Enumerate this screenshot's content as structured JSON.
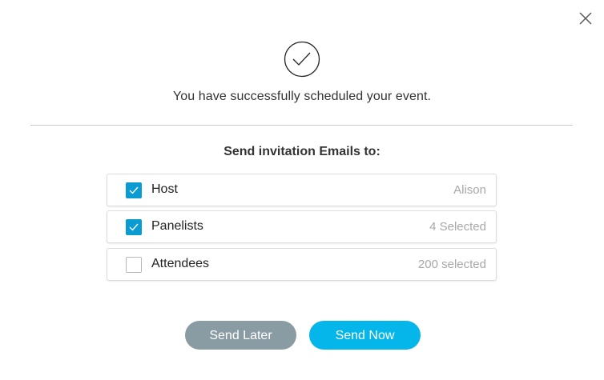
{
  "dialog": {
    "success_message": "You have successfully scheduled your event.",
    "section_heading": "Send invitation Emails to:"
  },
  "recipients": [
    {
      "label": "Host",
      "value": "Alison",
      "checked": true
    },
    {
      "label": "Panelists",
      "value": "4 Selected",
      "checked": true
    },
    {
      "label": "Attendees",
      "value": "200 selected",
      "checked": false
    }
  ],
  "buttons": {
    "send_later": "Send Later",
    "send_now": "Send Now"
  },
  "icons": {
    "close": "close-icon",
    "success": "checkmark-circle-icon",
    "check": "checkmark-icon"
  },
  "colors": {
    "checkbox_checked": "#0a9bd2",
    "send_now_bg": "#05b6ea",
    "send_later_bg": "#8a9ca3",
    "divider": "#c8c8c8"
  }
}
